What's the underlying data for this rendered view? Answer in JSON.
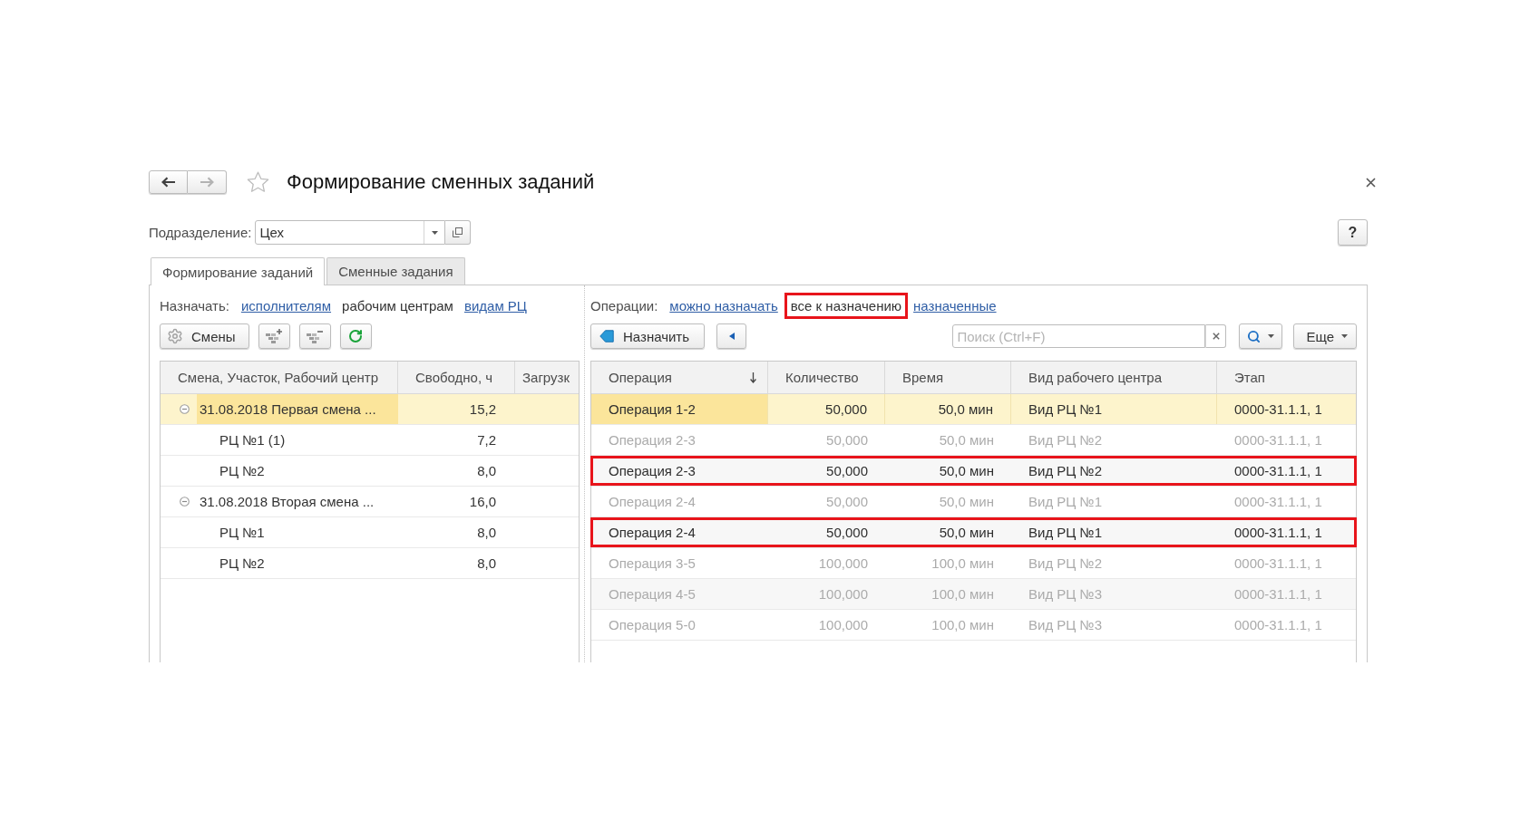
{
  "window": {
    "title": "Формирование сменных заданий",
    "favorite": false
  },
  "navigation": [
    {
      "kind": "back",
      "disabled": false
    },
    {
      "kind": "forward",
      "disabled": true
    }
  ],
  "department": {
    "label": "Подразделение:",
    "value": "Цех"
  },
  "help_button": "?",
  "tabs": [
    {
      "label": "Формирование заданий",
      "selected": true
    },
    {
      "label": "Сменные задания",
      "selected": false
    }
  ],
  "assign_panel": {
    "mode_label": "Назначать:",
    "modes": [
      {
        "label": "исполнителям",
        "selected": false
      },
      {
        "label": "рабочим центрам",
        "selected": true
      },
      {
        "label": "видам РЦ",
        "selected": false
      }
    ],
    "toolbar": [
      {
        "kind": "shifts",
        "label": "Смены"
      },
      {
        "kind": "plus"
      },
      {
        "kind": "minus"
      },
      {
        "kind": "refresh"
      }
    ],
    "table": {
      "columns": [
        "Смена, Участок, Рабочий центр",
        "Свободно, ч",
        "Загрузк"
      ],
      "rows": [
        {
          "cells": [
            "31.08.2018 Первая смена ...",
            "15,2"
          ],
          "selected": true,
          "expanded": true,
          "children": [
            {
              "cells": [
                "РЦ №1 (1)",
                "7,2"
              ],
              "selected": false
            },
            {
              "cells": [
                "РЦ №2",
                "8,0"
              ],
              "selected": false
            }
          ]
        },
        {
          "cells": [
            "31.08.2018 Вторая смена ...",
            "16,0"
          ],
          "selected": false,
          "expanded": true,
          "children": [
            {
              "cells": [
                "РЦ №1",
                "8,0"
              ],
              "selected": false
            },
            {
              "cells": [
                "РЦ №2",
                "8,0"
              ],
              "selected": false
            }
          ]
        }
      ]
    }
  },
  "operations_panel": {
    "filter_label": "Операции:",
    "filters": [
      {
        "label": "можно назначать",
        "selected": false,
        "highlighted": false
      },
      {
        "label": "все к назначению",
        "selected": true,
        "highlighted": true
      },
      {
        "label": "назначенные",
        "selected": false,
        "highlighted": false
      }
    ],
    "toolbar": [
      {
        "kind": "assign",
        "label": "Назначить"
      },
      {
        "kind": "return"
      },
      {
        "kind": "search",
        "placeholder": "Поиск (Ctrl+F)"
      },
      {
        "kind": "find"
      },
      {
        "kind": "more",
        "label": "Еще"
      }
    ],
    "table": {
      "columns": [
        {
          "label": "Операция",
          "sorted": true
        },
        {
          "label": "Количество",
          "sorted": false
        },
        {
          "label": "Время",
          "sorted": false
        },
        {
          "label": "Вид рабочего центра",
          "sorted": false
        },
        {
          "label": "Этап",
          "sorted": false
        }
      ],
      "rows": [
        {
          "cells": [
            "Операция 1-2",
            "50,000",
            "50,0 мин",
            "Вид РЦ №1",
            "0000-31.1.1, 1"
          ],
          "selected": true,
          "dimmed": false,
          "highlighted": false
        },
        {
          "cells": [
            "Операция 2-3",
            "50,000",
            "50,0 мин",
            "Вид РЦ №2",
            "0000-31.1.1, 1"
          ],
          "selected": false,
          "dimmed": true,
          "highlighted": false
        },
        {
          "cells": [
            "Операция 2-3",
            "50,000",
            "50,0 мин",
            "Вид РЦ №2",
            "0000-31.1.1, 1"
          ],
          "selected": false,
          "dimmed": false,
          "highlighted": true
        },
        {
          "cells": [
            "Операция 2-4",
            "50,000",
            "50,0 мин",
            "Вид РЦ №1",
            "0000-31.1.1, 1"
          ],
          "selected": false,
          "dimmed": true,
          "highlighted": false
        },
        {
          "cells": [
            "Операция 2-4",
            "50,000",
            "50,0 мин",
            "Вид РЦ №1",
            "0000-31.1.1, 1"
          ],
          "selected": false,
          "dimmed": false,
          "highlighted": true
        },
        {
          "cells": [
            "Операция 3-5",
            "100,000",
            "100,0 мин",
            "Вид РЦ №2",
            "0000-31.1.1, 1"
          ],
          "selected": false,
          "dimmed": true,
          "highlighted": false
        },
        {
          "cells": [
            "Операция 4-5",
            "100,000",
            "100,0 мин",
            "Вид РЦ №3",
            "0000-31.1.1, 1"
          ],
          "selected": false,
          "dimmed": true,
          "highlighted": false
        },
        {
          "cells": [
            "Операция 5-0",
            "100,000",
            "100,0 мин",
            "Вид РЦ №3",
            "0000-31.1.1, 1"
          ],
          "selected": false,
          "dimmed": true,
          "highlighted": false
        }
      ]
    }
  }
}
